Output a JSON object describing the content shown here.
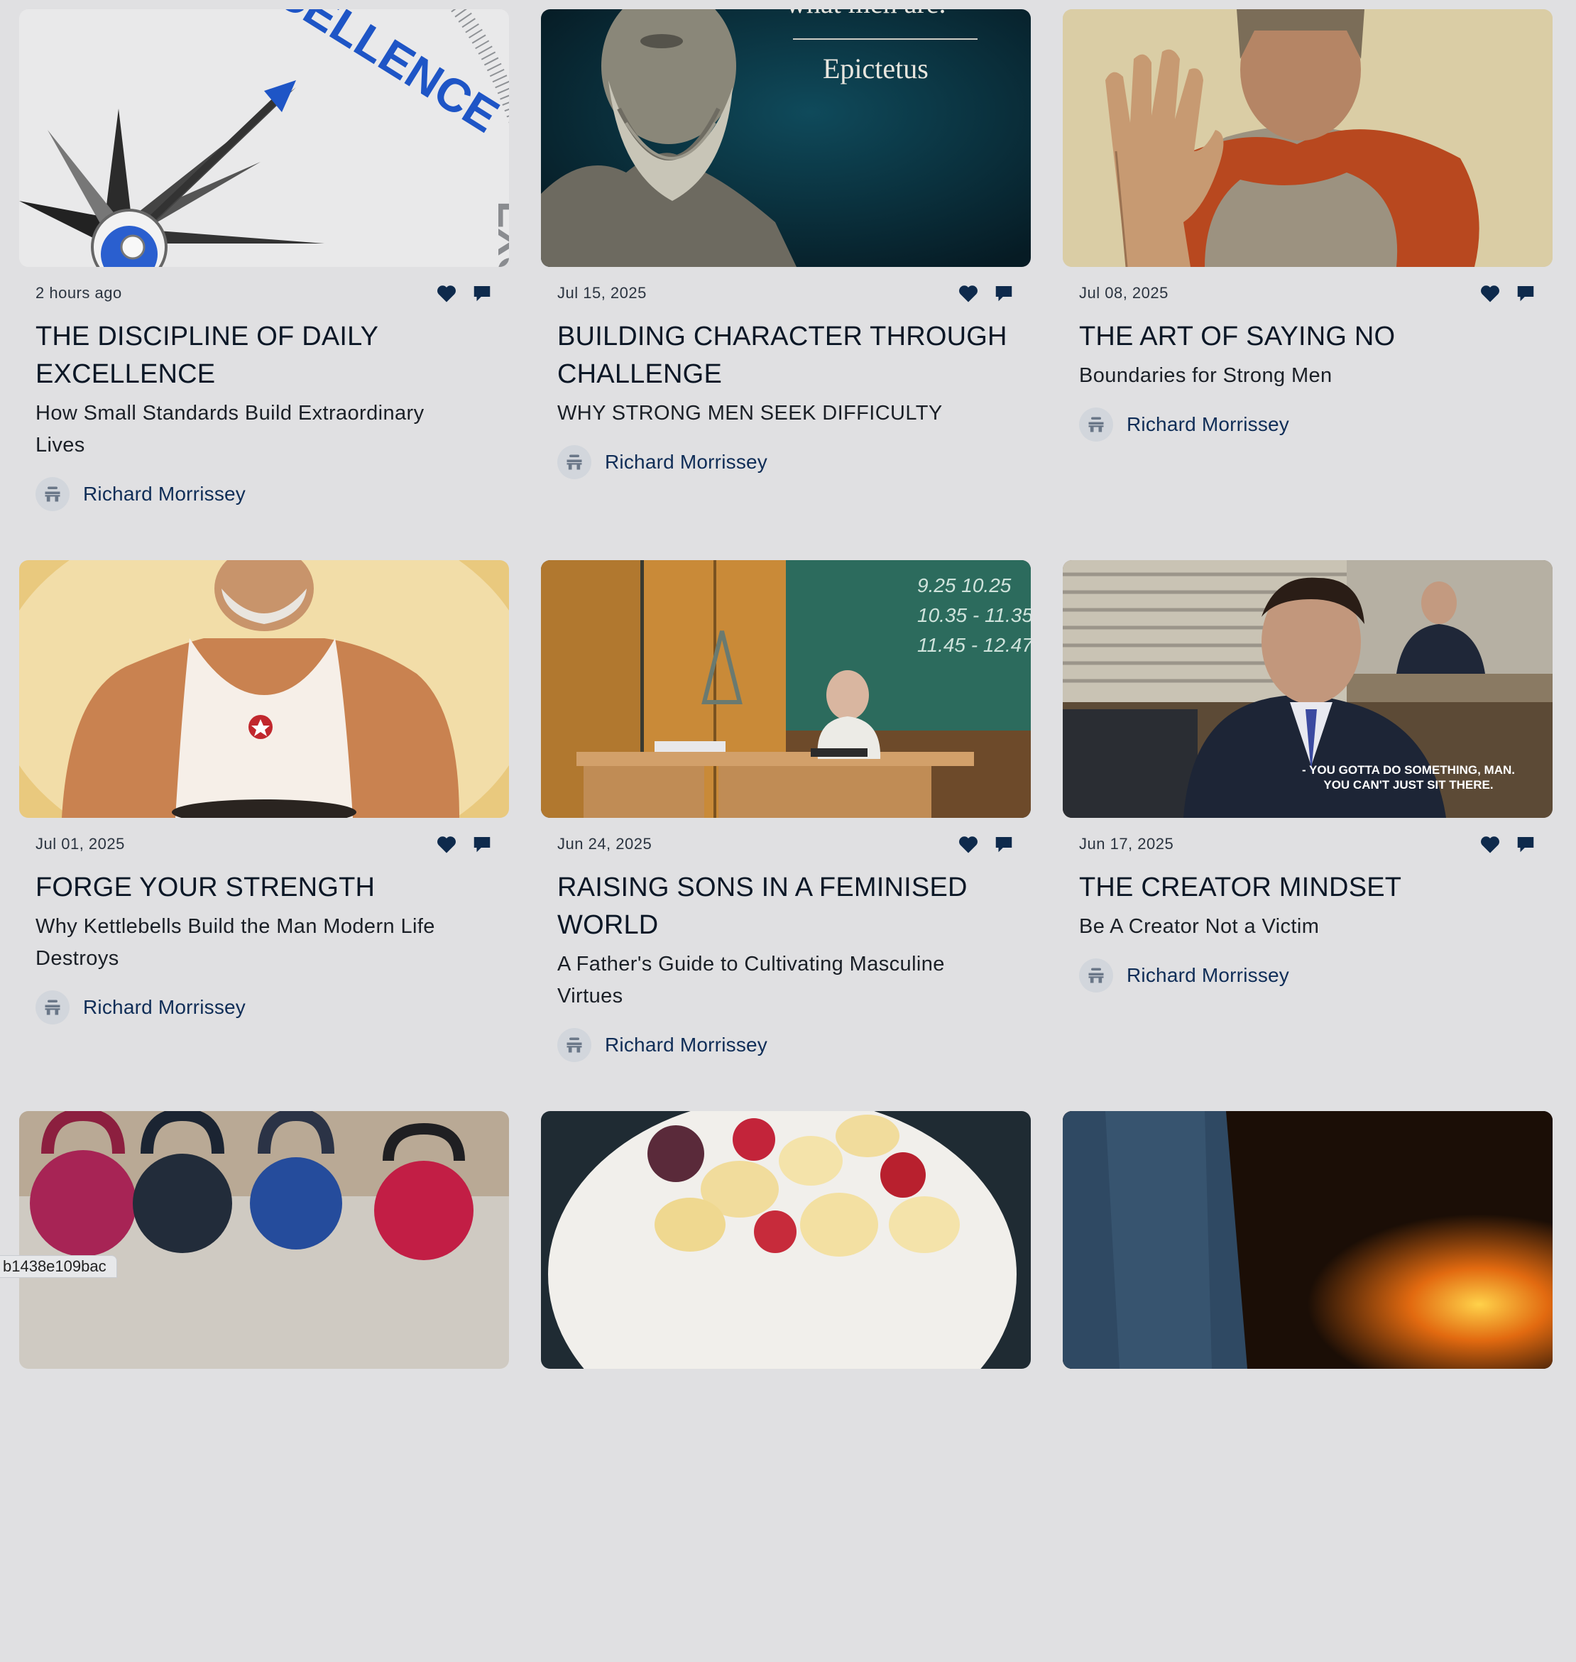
{
  "author_name": "Richard Morrissey",
  "cards": [
    {
      "date": "2 hours ago",
      "title_lines": [
        "THE DISCIPLINE OF DAILY",
        "EXCELLENCE"
      ],
      "subtitle_lines": [
        "How Small Standards Build Extraordinary",
        "Lives"
      ],
      "author": "Richard Morrissey",
      "image": "compass-excellence"
    },
    {
      "date": "Jul 15, 2025",
      "title_lines": [
        "BUILDING CHARACTER THROUGH",
        "CHALLENGE"
      ],
      "subtitle_lines": [
        "WHY STRONG MEN SEEK DIFFICULTY"
      ],
      "author": "Richard Morrissey",
      "image": "epictetus-bust",
      "image_text": "Epictetus",
      "image_text_top": "what men are."
    },
    {
      "date": "Jul 08, 2025",
      "title_lines": [
        "THE ART OF SAYING NO"
      ],
      "subtitle_lines": [
        "Boundaries for Strong Men"
      ],
      "author": "Richard Morrissey",
      "image": "roman-soldier-hand"
    },
    {
      "date": "Jul 01, 2025",
      "title_lines": [
        "FORGE YOUR STRENGTH"
      ],
      "subtitle_lines": [
        "Why Kettlebells Build the Man Modern Life",
        "Destroys"
      ],
      "author": "Richard Morrissey",
      "image": "man-tank-top"
    },
    {
      "date": "Jun 24, 2025",
      "title_lines": [
        "RAISING SONS IN A FEMINISED",
        "WORLD"
      ],
      "subtitle_lines": [
        "A Father's Guide to Cultivating Masculine",
        "Virtues"
      ],
      "author": "Richard Morrissey",
      "image": "classroom-teacher",
      "image_text_lines": [
        "9.25  10.25",
        "10.35 - 11.35",
        "11.45 - 12.47"
      ]
    },
    {
      "date": "Jun 17, 2025",
      "title_lines": [
        "THE CREATOR MINDSET"
      ],
      "subtitle_lines": [
        "Be A Creator Not a Victim"
      ],
      "author": "Richard Morrissey",
      "image": "office-scene",
      "image_text_lines": [
        "- YOU GOTTA DO SOMETHING, MAN.",
        "YOU CAN'T JUST SIT THERE."
      ]
    },
    {
      "image": "kettlebells"
    },
    {
      "image": "fruit-bowl"
    },
    {
      "image": "forge-fire"
    }
  ],
  "status_url": "b1438e109bac",
  "colors": {
    "background": "#e0e0e2",
    "author": "#0f2d57",
    "icon": "#0e2a4c"
  }
}
